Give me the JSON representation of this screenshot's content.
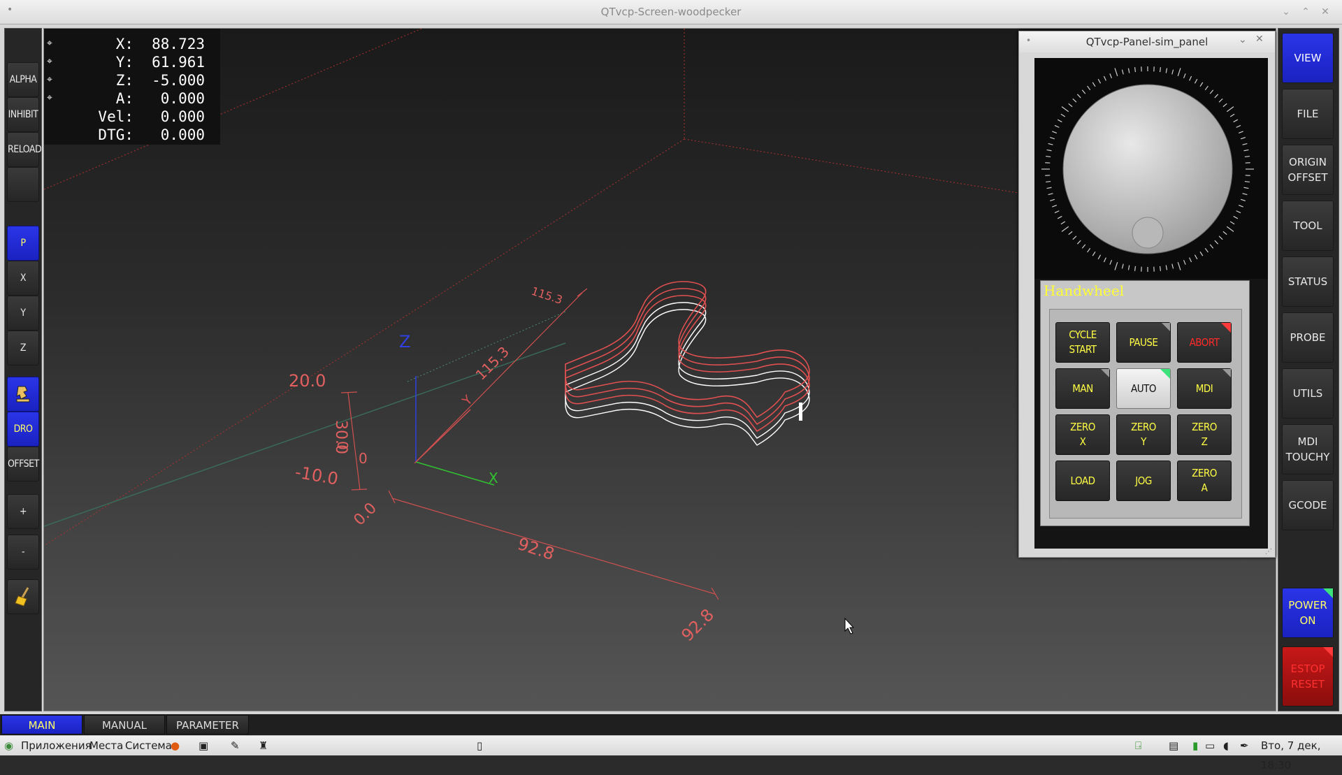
{
  "window": {
    "title": "QTvcp-Screen-woodpecker"
  },
  "left_bar": {
    "buttons": [
      {
        "label": "ALPHA"
      },
      {
        "label": "INHIBIT"
      },
      {
        "label": "RELOAD"
      },
      {
        "label": ""
      },
      {
        "label": "P"
      },
      {
        "label": "X"
      },
      {
        "label": "Y"
      },
      {
        "label": "Z"
      },
      {
        "label": ""
      },
      {
        "label": "DRO"
      },
      {
        "label": "OFFSET"
      },
      {
        "label": ""
      },
      {
        "label": "+"
      },
      {
        "label": "-"
      },
      {
        "label": ""
      }
    ]
  },
  "right_bar": {
    "buttons": [
      {
        "label": "VIEW"
      },
      {
        "label": "FILE"
      },
      {
        "label": "ORIGIN\nOFFSET"
      },
      {
        "label": "TOOL"
      },
      {
        "label": "STATUS"
      },
      {
        "label": "PROBE"
      },
      {
        "label": "UTILS"
      },
      {
        "label": "MDI\nTOUCHY"
      },
      {
        "label": "GCODE"
      },
      {
        "label": "POWER\nON"
      },
      {
        "label": "ESTOP\nRESET"
      }
    ]
  },
  "dro": {
    "rows": [
      {
        "label": "X:",
        "value": "88.723"
      },
      {
        "label": "Y:",
        "value": "61.961"
      },
      {
        "label": "Z:",
        "value": "-5.000"
      },
      {
        "label": "A:",
        "value": "0.000"
      },
      {
        "label": "Vel:",
        "value": "0.000"
      },
      {
        "label": "DTG:",
        "value": "0.000"
      }
    ]
  },
  "viewport": {
    "extents": {
      "dim_115_a": "115.3",
      "dim_115_b": "115.3",
      "dim_20": "20.0",
      "dim_30": "30.0",
      "dim_0a": "0",
      "dim_0b": "0",
      "dim_m10": "-10.0",
      "dim_00": "0.0",
      "dim_928a": "92.8",
      "dim_928b": "92.8",
      "axis_x": "X",
      "axis_y": "Y",
      "axis_z": "Z"
    }
  },
  "panel": {
    "title": "QTvcp-Panel-sim_panel",
    "handwheel_label": "Handwheel",
    "buttons": [
      {
        "label": "CYCLE\nSTART"
      },
      {
        "label": "PAUSE"
      },
      {
        "label": "ABORT"
      },
      {
        "label": "MAN"
      },
      {
        "label": "AUTO"
      },
      {
        "label": "MDI"
      },
      {
        "label": "ZERO\nX"
      },
      {
        "label": "ZERO\nY"
      },
      {
        "label": "ZERO\nZ"
      },
      {
        "label": "LOAD"
      },
      {
        "label": "JOG"
      },
      {
        "label": "ZERO\nA"
      }
    ]
  },
  "tabs": [
    {
      "label": "MAIN"
    },
    {
      "label": "MANUAL"
    },
    {
      "label": "PARAMETER"
    }
  ],
  "taskbar": {
    "apps": "Приложения",
    "places": "Места",
    "system": "Система",
    "clock": "Вто, 7 дек, 18:30"
  },
  "colors": {
    "accent_blue": "#1f2ad6",
    "label_yellow": "#ffff44",
    "toolpath_red": "#e05050",
    "estop_red": "#c81818"
  }
}
